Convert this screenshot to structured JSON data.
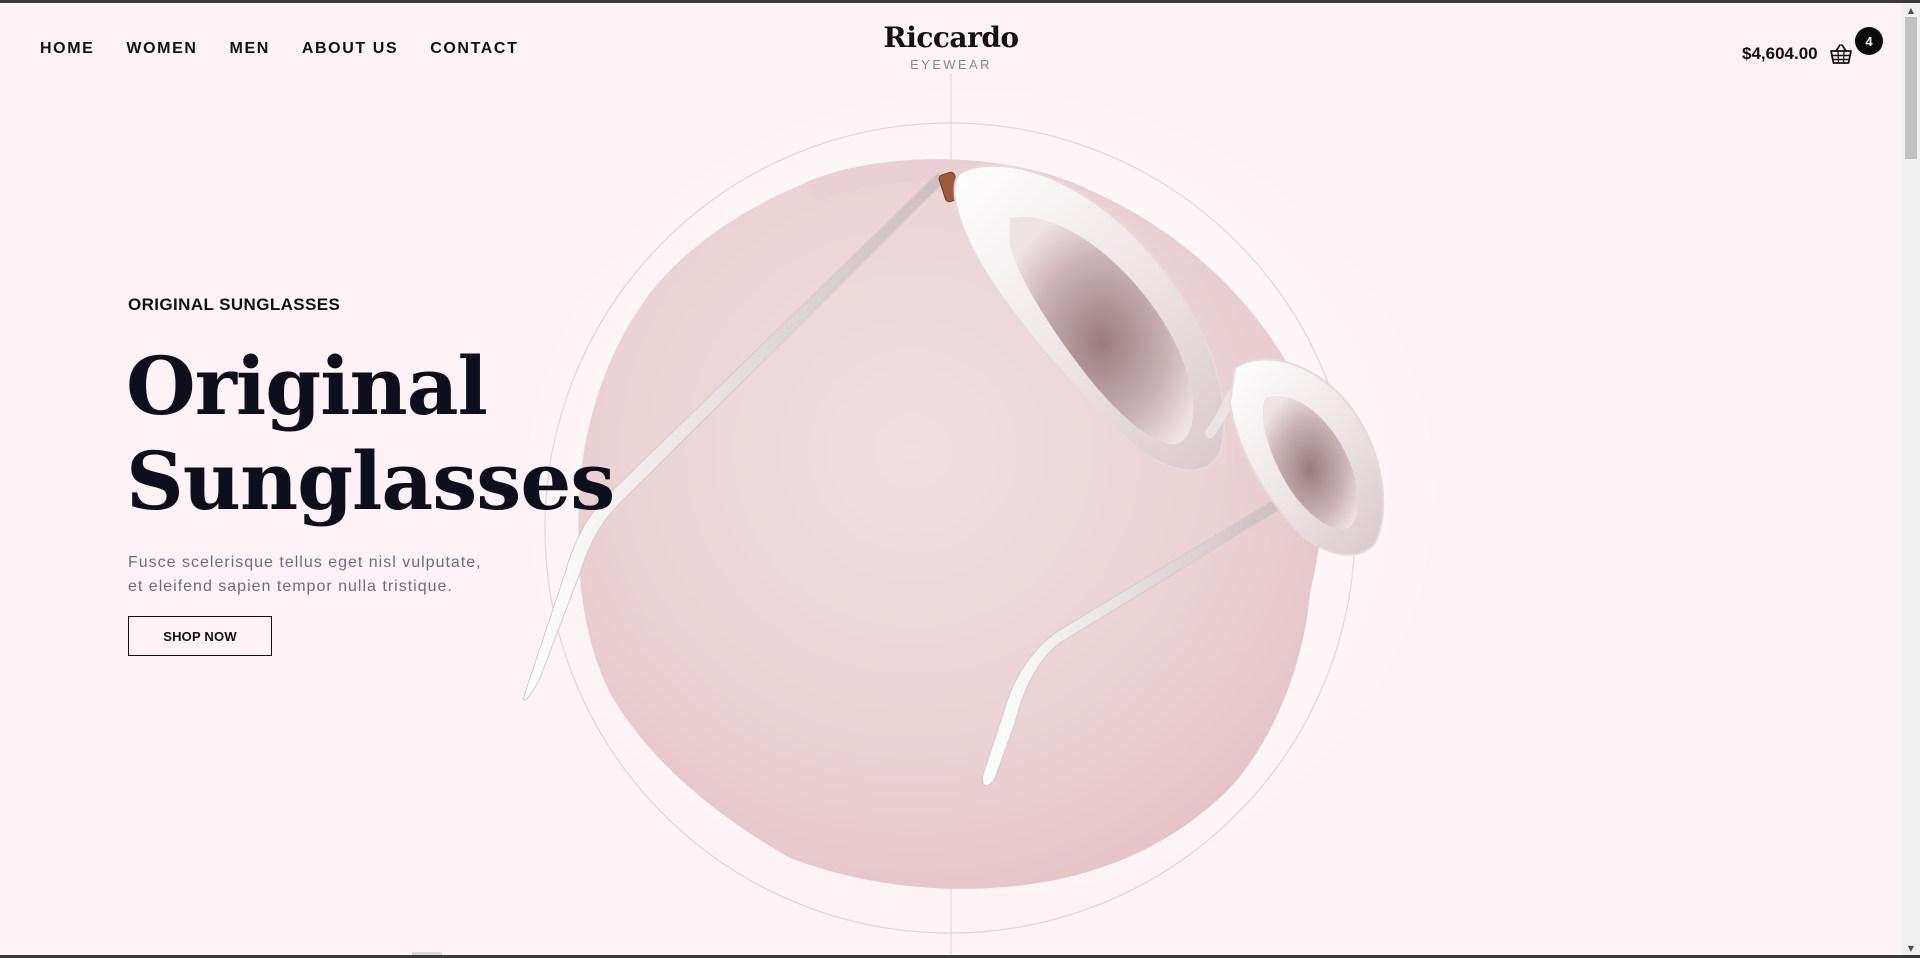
{
  "nav": {
    "items": [
      {
        "label": "HOME"
      },
      {
        "label": "WOMEN"
      },
      {
        "label": "MEN"
      },
      {
        "label": "ABOUT US"
      },
      {
        "label": "CONTACT"
      }
    ]
  },
  "brand": {
    "name": "Riccardo",
    "tagline": "EYEWEAR"
  },
  "cart": {
    "total": "$4,604.00",
    "count": "4",
    "icon": "basket-icon"
  },
  "hero": {
    "eyebrow": "ORIGINAL SUNGLASSES",
    "title_line1": "Original",
    "title_line2": "Sunglasses",
    "description_line1": "Fusce scelerisque tellus eget nisl vulputate,",
    "description_line2": "et eleifend sapien tempor nulla tristique.",
    "cta": "SHOP NOW",
    "image": "sunglasses-product-image"
  },
  "colors": {
    "background": "#fdf2f6",
    "text": "#111111",
    "heading": "#0d0f1c",
    "muted": "#6b6e80",
    "blob": "#e8c4c8",
    "badge": "#0b0b0b"
  }
}
